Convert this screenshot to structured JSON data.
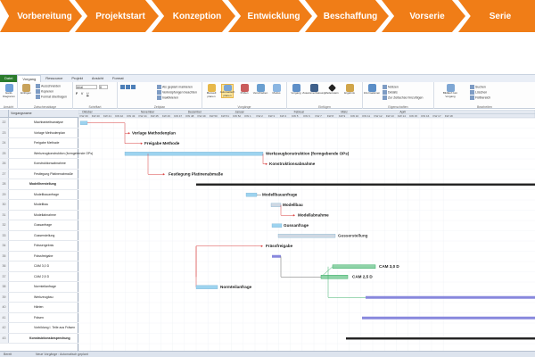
{
  "phases": [
    "Vorbereitung",
    "Projektstart",
    "Konzeption",
    "Entwicklung",
    "Beschaffung",
    "Vorserie",
    "Serie"
  ],
  "colors": {
    "phase": "#f07d17",
    "bar": "#9dd3ef",
    "critical": "#d94040",
    "green": "#3caf6a",
    "summary": "#222222",
    "purple": "#8888dd"
  },
  "ribbon": {
    "tabs": [
      "Datei",
      "Vorgang",
      "Ressource",
      "Projekt",
      "Ansicht",
      "Format"
    ],
    "active_tab": "Vorgang",
    "groups": [
      {
        "label": "Ansicht",
        "buttons": [
          "Gantt-Diagramm"
        ]
      },
      {
        "label": "Zwischenablage",
        "buttons": [
          "Einfügen",
          "Ausschneiden",
          "Kopieren",
          "Format übertragen"
        ]
      },
      {
        "label": "Schriftart",
        "buttons": [
          "Arial",
          "8"
        ]
      },
      {
        "label": "Zeitplan",
        "buttons": [
          "Als geplant markieren",
          "Verknüpfungen beachten",
          "Inaktivieren"
        ]
      },
      {
        "label": "Vorgänge",
        "buttons": [
          "Manuell planen",
          "Automatisch planen",
          "Prüfen",
          "Verschieben",
          "Modus"
        ]
      },
      {
        "label": "Einfügen",
        "buttons": [
          "Vorgang",
          "Zusammenfassung",
          "Meilenstein",
          "Ergebnis"
        ]
      },
      {
        "label": "Eigenschaften",
        "buttons": [
          "Informationen",
          "Notizen",
          "Details",
          "Zur Zeitachse hinzufügen"
        ]
      },
      {
        "label": "Bearbeiten",
        "buttons": [
          "Bildlauf zum Vorgang",
          "Suchen",
          "Löschen",
          "Füllbereich"
        ]
      }
    ]
  },
  "table": {
    "header": "Vorgangsname",
    "rows": [
      {
        "id": "22",
        "name": "Machbarkeitsanalyse",
        "summary": false
      },
      {
        "id": "23",
        "name": "Vorlage Methodenplan",
        "summary": false
      },
      {
        "id": "24",
        "name": "Freigabe Methode",
        "summary": false
      },
      {
        "id": "25",
        "name": "Werkzeugkonstruktion (formgebende OPs)",
        "summary": false
      },
      {
        "id": "26",
        "name": "Konstruktionsabnahme",
        "summary": false
      },
      {
        "id": "27",
        "name": "Festlegung Platinenabmaße",
        "summary": false
      },
      {
        "id": "28",
        "name": "Modellherstellung",
        "summary": true
      },
      {
        "id": "29",
        "name": "Modellbauanfrage",
        "summary": false
      },
      {
        "id": "30",
        "name": "Modellbau",
        "summary": false
      },
      {
        "id": "31",
        "name": "Modellabnahme",
        "summary": false
      },
      {
        "id": "32",
        "name": "Gussanfrage",
        "summary": false
      },
      {
        "id": "33",
        "name": "Gusserstellung",
        "summary": false
      },
      {
        "id": "34",
        "name": "Frässergebnis",
        "summary": false
      },
      {
        "id": "35",
        "name": "Frässfreigabe",
        "summary": false
      },
      {
        "id": "36",
        "name": "CAM 3,0 D",
        "summary": false
      },
      {
        "id": "37",
        "name": "CAM 2,5 D",
        "summary": false
      },
      {
        "id": "38",
        "name": "Normteilanfrage",
        "summary": false
      },
      {
        "id": "39",
        "name": "Werkzeugbau",
        "summary": false
      },
      {
        "id": "40",
        "name": "Härten",
        "summary": false
      },
      {
        "id": "41",
        "name": "Fräsen",
        "summary": false
      },
      {
        "id": "42",
        "name": "Vorbildung I. Teile aus Fräsen",
        "summary": false
      },
      {
        "id": "43",
        "name": "Konstruktionsbesprechung",
        "summary": true
      }
    ]
  },
  "timeline": {
    "months": [
      "Oktober",
      "November",
      "Dezember",
      "Januar",
      "Februar",
      "März",
      "April"
    ],
    "weeks": [
      "KW 39",
      "KW 40",
      "KW 41",
      "KW 42",
      "KW 43",
      "KW 44",
      "KW 45",
      "KW 46",
      "KW 47",
      "KW 48",
      "KW 49",
      "KW 50",
      "KW 51",
      "KW 52",
      "KW 1",
      "KW 2",
      "KW 3",
      "KW 4",
      "KW 5",
      "KW 6",
      "KW 7",
      "KW 8",
      "KW 9",
      "KW 10",
      "KW 11",
      "KW 12",
      "KW 13",
      "KW 14",
      "KW 15",
      "KW 16",
      "KW 17",
      "KW 18"
    ]
  },
  "gantt_labels": {
    "methodenplan": "Vorlage Methodenplan",
    "freigabe": "Freigabe Methode",
    "werkzeug": "Werkzeugkonstruktion (formgebende OPs)",
    "konstruktion": "Konstruktionsabnahme",
    "platinen": "Festlegung Platinenabmaße",
    "modellbauanfrage": "Modellbauanfrage",
    "modellbau": "Modellbau",
    "modellabnahme": "Modellabnahme",
    "gussanfrage": "Gussanfrage",
    "gusserstellung": "Gusserstellung",
    "fraesfreigabe": "Frässfreigabe",
    "cam30": "CAM 3,0 D",
    "cam25": "CAM 2,5 D",
    "normteil": "Normteilanfrage"
  },
  "status": {
    "left": "Bereit",
    "mode": "Neue Vorgänge : Automatisch geplant"
  }
}
